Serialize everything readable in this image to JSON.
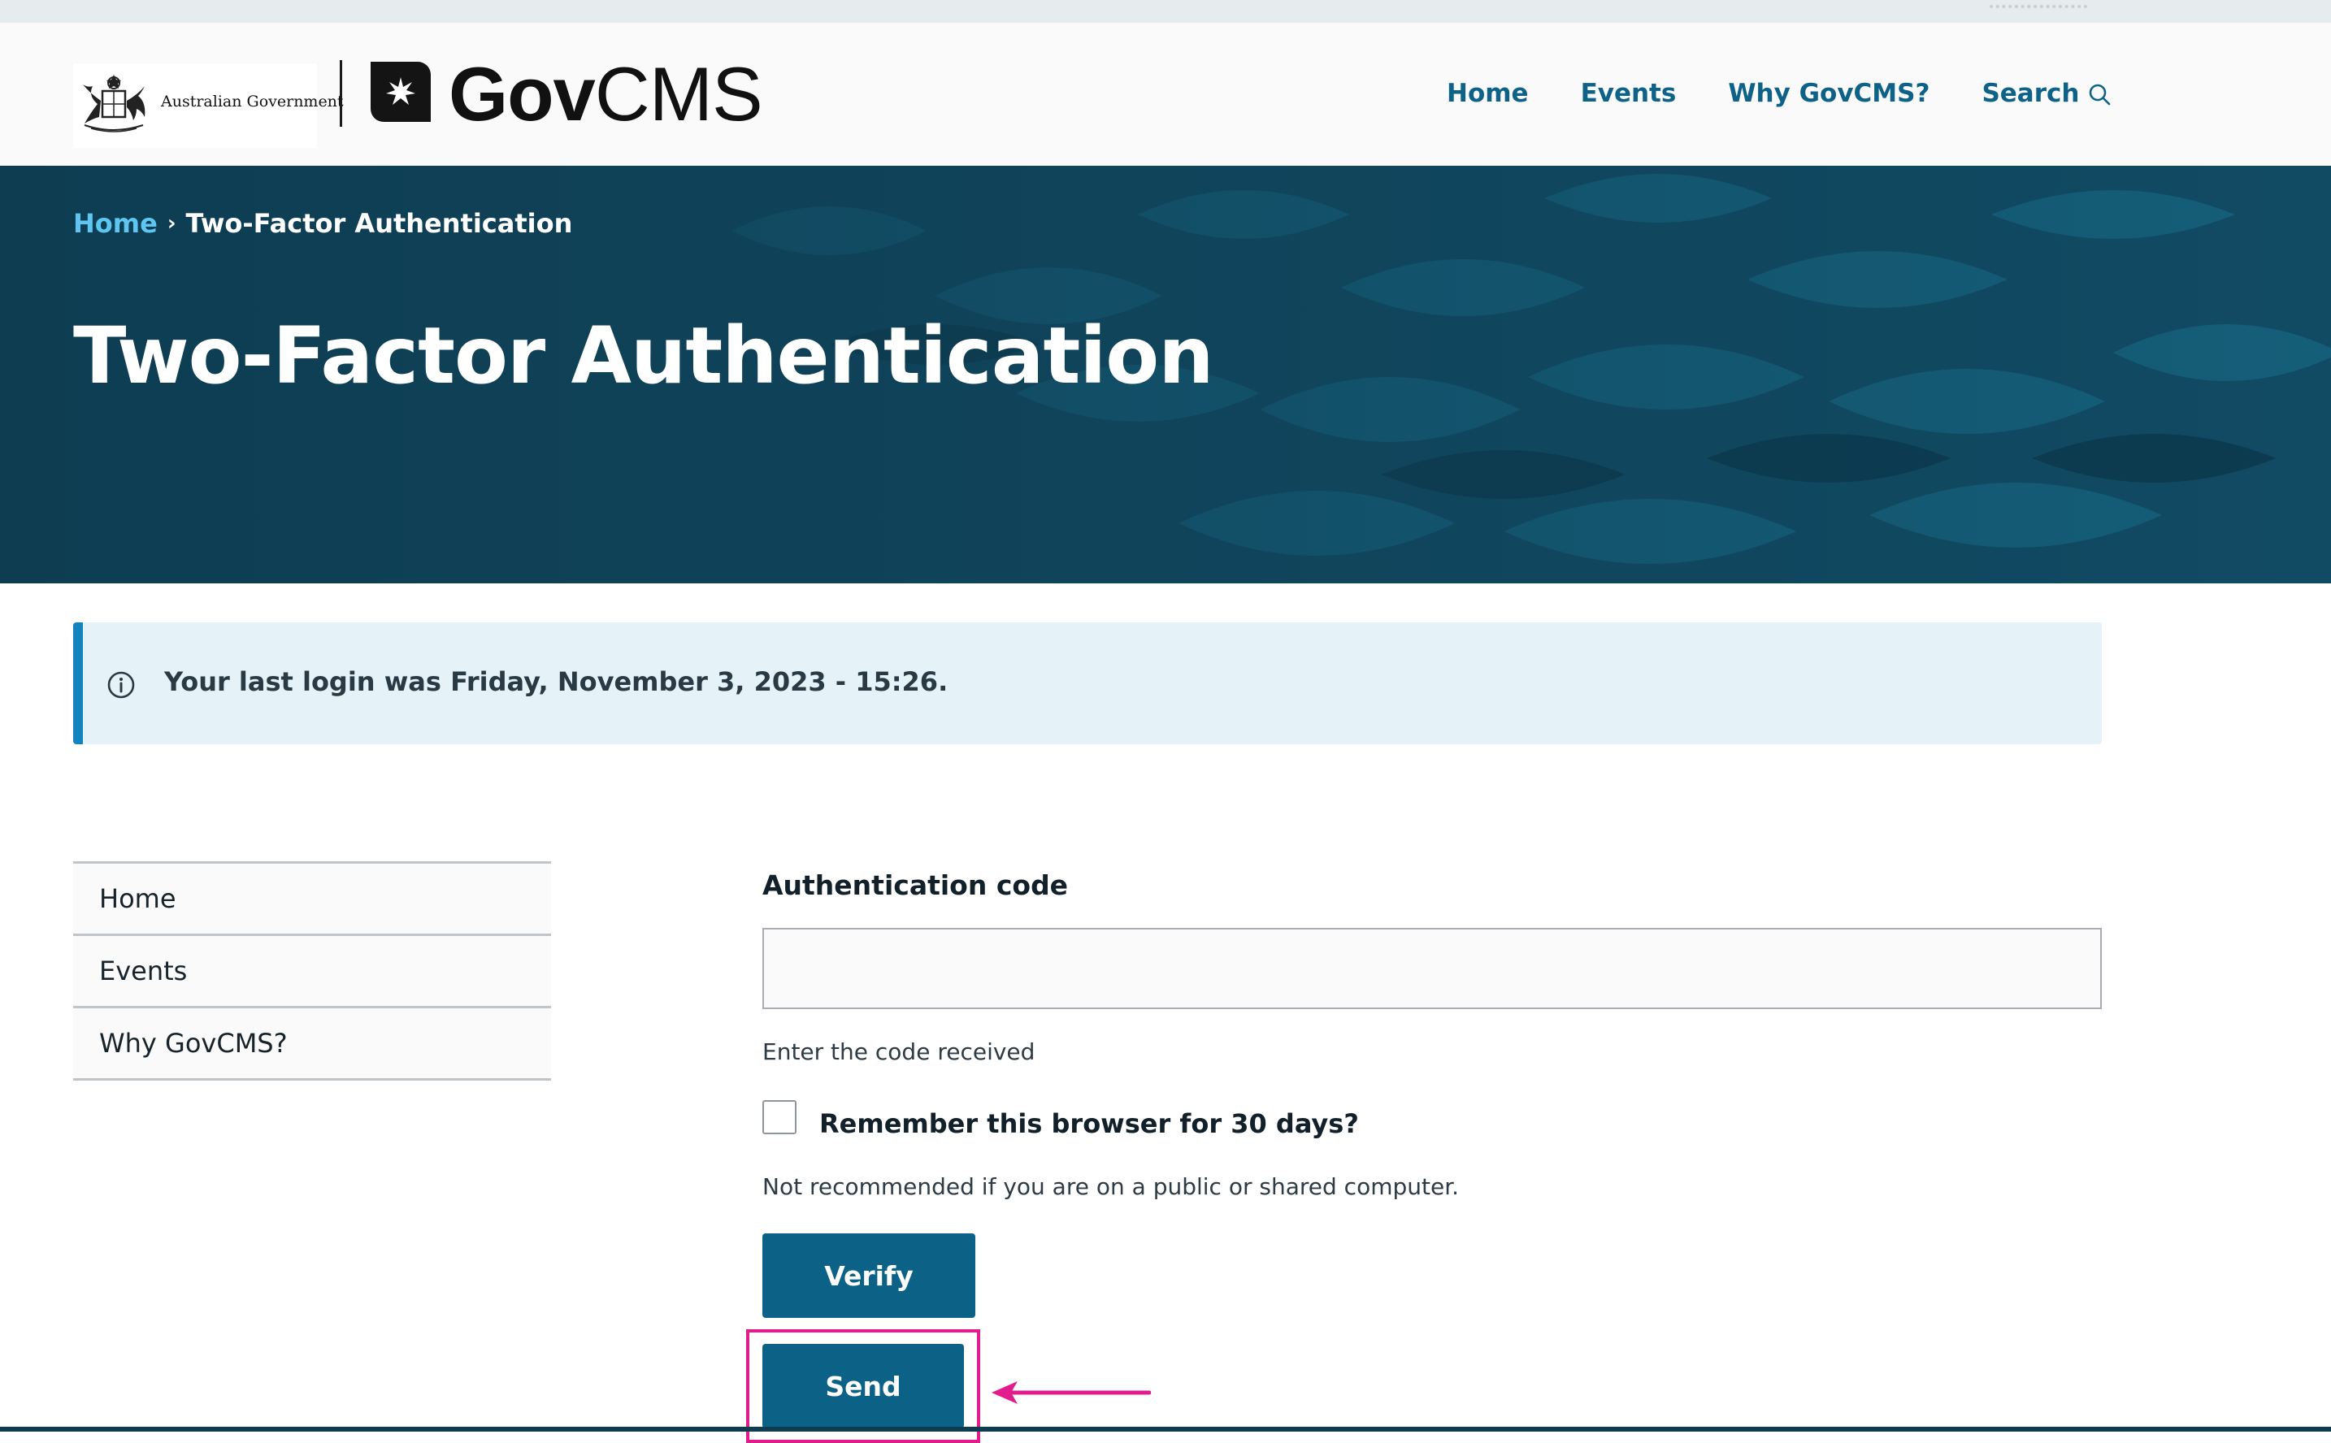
{
  "header": {
    "gov_text": "Australian Government",
    "logo": {
      "bold": "Gov",
      "light": "CMS"
    },
    "nav": [
      {
        "label": "Home"
      },
      {
        "label": "Events"
      },
      {
        "label": "Why GovCMS?"
      },
      {
        "label": "Search",
        "icon": "search-icon"
      }
    ]
  },
  "hero": {
    "breadcrumb": {
      "home": "Home",
      "separator": "›",
      "current": "Two-Factor Authentication"
    },
    "title": "Two-Factor Authentication"
  },
  "alert": {
    "icon": "info-icon",
    "message": "Your last login was Friday, November 3, 2023 - 15:26."
  },
  "sidebar": {
    "items": [
      {
        "label": "Home"
      },
      {
        "label": "Events"
      },
      {
        "label": "Why GovCMS?"
      }
    ]
  },
  "form": {
    "code_label": "Authentication code",
    "code_value": "",
    "code_help": "Enter the code received",
    "remember_label": "Remember this browser for 30 days?",
    "remember_checked": false,
    "remember_note": "Not recommended if you are on a public or shared computer.",
    "verify_label": "Verify",
    "send_label": "Send"
  },
  "annotation": {
    "highlight_color": "#e31c8d"
  },
  "colors": {
    "accent": "#0c6187",
    "hero_bg": "#0e3d52",
    "link_light": "#5fc6f1",
    "alert_bg": "#e5f2f8",
    "alert_border": "#1283bd"
  }
}
